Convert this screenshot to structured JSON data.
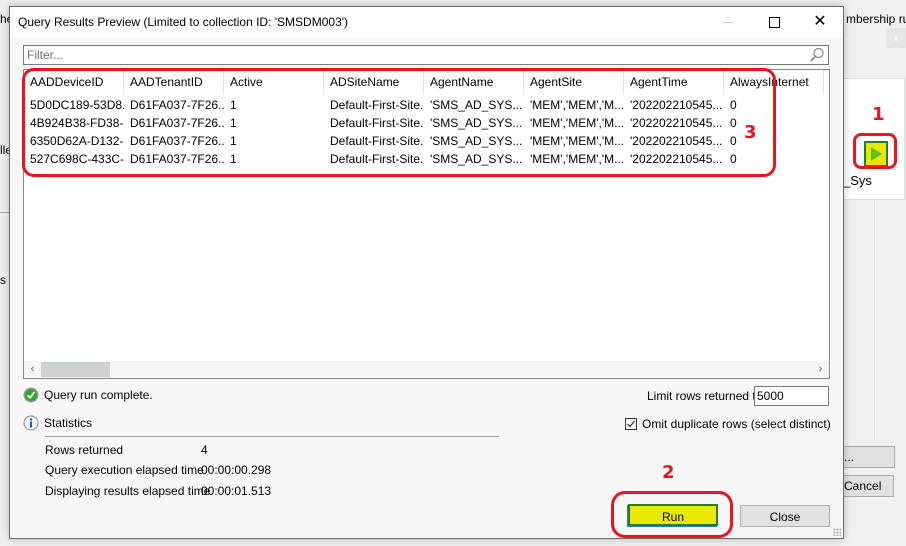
{
  "background": {
    "left_fragments": [
      "he",
      "lle",
      "s r"
    ],
    "right_header_text": "mbership rules",
    "right_close_glyph": "x",
    "right_list_text": "_Sys",
    "right_buttons": [
      "...",
      "Cancel"
    ]
  },
  "dialog": {
    "title": "Query Results Preview (Limited to collection ID: 'SMSDM003')",
    "window_controls": {
      "minimize": "—",
      "maximize": "☐",
      "close": "✕"
    },
    "filter": {
      "placeholder": "Filter...",
      "value": ""
    },
    "grid": {
      "columns": [
        "AADDeviceID",
        "AADTenantID",
        "Active",
        "ADSiteName",
        "AgentName",
        "AgentSite",
        "AgentTime",
        "AlwaysInternet"
      ],
      "rows": [
        [
          "5D0DC189-53D8...",
          "D61FA037-7F26...",
          "1",
          "Default-First-Site...",
          "'SMS_AD_SYS...",
          "'MEM','MEM','M...",
          "'202202210545...",
          "0"
        ],
        [
          "4B924B38-FD38-...",
          "D61FA037-7F26...",
          "1",
          "Default-First-Site...",
          "'SMS_AD_SYS...",
          "'MEM','MEM','M...",
          "'202202210545...",
          "0"
        ],
        [
          "6350D62A-D132-...",
          "D61FA037-7F26...",
          "1",
          "Default-First-Site...",
          "'SMS_AD_SYS...",
          "'MEM','MEM','M...",
          "'202202210545...",
          "0"
        ],
        [
          "527C698C-433C-...",
          "D61FA037-7F26...",
          "1",
          "Default-First-Site...",
          "'SMS_AD_SYS...",
          "'MEM','MEM','M...",
          "'202202210545...",
          "0"
        ]
      ],
      "scroll_left": "‹",
      "scroll_right": "›"
    },
    "status": {
      "icon": "check-circle-icon",
      "text": "Query run complete."
    },
    "statistics": {
      "heading": "Statistics",
      "items": [
        {
          "label": "Rows returned",
          "value": "4"
        },
        {
          "label": "Query execution elapsed time",
          "value": "00:00:00.298"
        },
        {
          "label": "Displaying results elapsed time",
          "value": "00:00:01.513"
        }
      ]
    },
    "limit": {
      "label": "Limit rows returned to",
      "value": "5000"
    },
    "omit_duplicates": {
      "label": "Omit duplicate rows (select distinct)",
      "checked": true
    },
    "buttons": {
      "run": "Run",
      "close": "Close"
    }
  },
  "annotations": {
    "labels": [
      "1",
      "2",
      "3"
    ],
    "color": "#e8141e",
    "highlight_color": "#e8e800"
  }
}
